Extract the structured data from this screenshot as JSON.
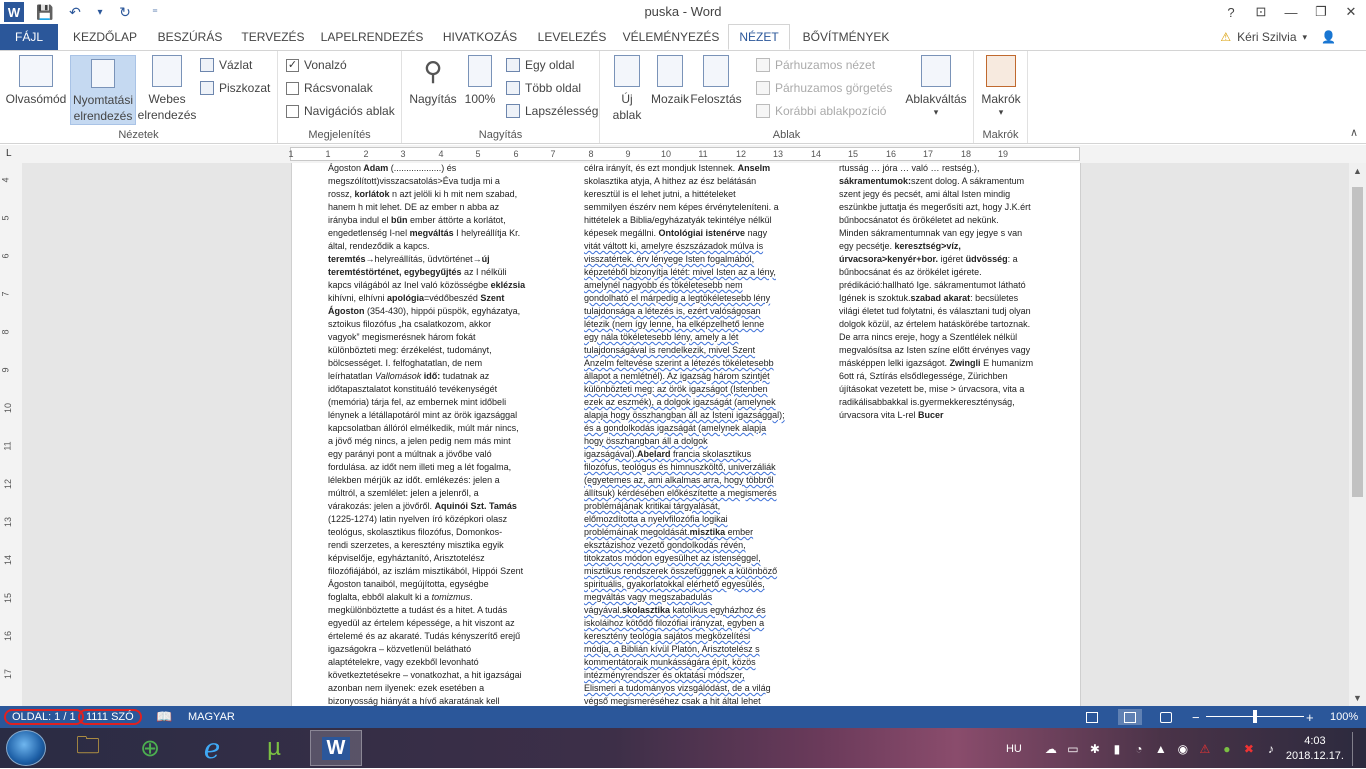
{
  "title_bar": {
    "doc_title": "puska - Word",
    "help": "?",
    "ribbon_display": "⊡",
    "minimize": "—",
    "restore": "❐",
    "close": "✕"
  },
  "qat": {
    "word_logo": "W",
    "save": "💾",
    "undo": "↶",
    "undo_dropdown": "▾",
    "redo": "↻",
    "customize": "⁼"
  },
  "tabs": [
    "FÁJL",
    "KEZDŐLAP",
    "BESZÚRÁS",
    "TERVEZÉS",
    "LAPELRENDEZÉS",
    "HIVATKOZÁS",
    "LEVELEZÉS",
    "VÉLEMÉNYEZÉS",
    "NÉZET",
    "BŐVÍTMÉNYEK"
  ],
  "user": {
    "name": "Kéri Szilvia",
    "warning_icon": "⚠",
    "dropdown": "▾",
    "avatar_icon": "👤"
  },
  "ribbon": {
    "nezetek": {
      "label": "Nézetek",
      "read": "Olvasómód",
      "print": "Nyomtatási elrendezés",
      "web": "Webes elrendezés",
      "outline": "Vázlat",
      "draft": "Piszkozat"
    },
    "megjelenites": {
      "label": "Megjelenítés",
      "ruler": "Vonalzó",
      "ruler_check": "✓",
      "gridlines": "Rácsvonalak",
      "nav": "Navigációs ablak"
    },
    "nagyitas": {
      "label": "Nagyítás",
      "zoom": "Nagyítás",
      "percent100": "100%",
      "one_page": "Egy oldal",
      "multi_page": "Több oldal",
      "page_width": "Lapszélesség"
    },
    "ablak": {
      "label": "Ablak",
      "new_window": "Új ablak",
      "arrange": "Mozaik",
      "split": "Felosztás",
      "side_by_side": "Párhuzamos nézet",
      "sync_scroll": "Párhuzamos görgetés",
      "reset_pos": "Korábbi ablakpozíció",
      "switch": "Ablakváltás",
      "switch_arrow": "▾"
    },
    "makrok": {
      "label": "Makrók",
      "macros": "Makrók",
      "macros_arrow": "▾"
    },
    "collapse": "∧"
  },
  "ruler_marks": [
    "1",
    "1",
    "2",
    "3",
    "4",
    "5",
    "6",
    "7",
    "8",
    "9",
    "10",
    "11",
    "12",
    "13",
    "14",
    "15",
    "16",
    "17",
    "18",
    "19"
  ],
  "ruler_corner": "L",
  "vruler_marks": [
    "4",
    "5",
    "6",
    "7",
    "8",
    "9",
    "10",
    "11",
    "12",
    "13",
    "14",
    "15",
    "16",
    "17"
  ],
  "document": {
    "col1": [
      "Ágoston<b> Adam</b> (...................) és",
      "megszólított)visszacsatolás>Éva tudja mi a",
      "rossz, <b>korlátok</b> n azt jelöli ki h mit nem szabad,",
      "hanem h mit lehet. DE az ember n abba az",
      "irányba indul el <b>bűn</b> ember áttörte a korlátot,",
      "engedetlenség I-nel <b>megváltás</b> I helyreállítja Kr.",
      "által, rendeződik a kapcs.",
      "<b>teremtés</b>→helyreállítás, üdvtörténet→<b>új</b>",
      "<b>teremtéstörténet, egybegyűjtés</b> az I nélküli",
      "kapcs világából az Inel való közösségbe <b>eklézsia</b>",
      "kihívni, elhívni <b>apológia</b>=védőbeszéd <b>Szent</b>",
      "<b>Ágoston</b> (354-430), hippói püspök, egyházatya,",
      "sztoikus filozófus „ha csalatkozom, akkor",
      "vagyok” megismerésnek három fokát",
      "különbözteti meg: érzékelést, tudományt,",
      "bölcsességet. I. felfoghatatlan, de nem",
      "leírhatatlan <i>Vallomások</i> <b>idő:</b> tudatnak az",
      "időtapasztalatot konstituáló tevékenységét",
      "(memória) tárja fel, az embernek mint időbeli",
      "lénynek a létállapotáról mint az örök igazsággal",
      "kapcsolatban állóról elmélkedik, múlt már nincs,",
      "a jövő még nincs, a jelen pedig nem más mint",
      "egy parányi pont a múltnak a jövőbe való",
      "fordulása. az időt nem illeti meg a lét fogalma,",
      "lélekben mérjük az időt. emlékezés: jelen a",
      "múltról, a szemlélet: jelen a jelenről, a",
      "várakozás: jelen a jövőről. <b>Aquinói Szt. Tamás</b>",
      "(1225-1274) latin nyelven író középkori olasz",
      "teológus, skolasztikus filozófus, Domonkos-",
      "rendi szerzetes, a keresztény misztika egyik",
      "képviselője, egyháztanító, Arisztotelész",
      "filozófiájából, az iszlám misztikából, Hippói Szent",
      "Ágoston tanaiból, megújította, egységbe",
      "foglalta, ebből alakult ki a <i>tomizmus</i>.",
      "megkülönböztette a tudást és a hitet. A tudás",
      "egyedül az értelem képessége, a hit viszont az",
      "értelemé és az akaraté. Tudás kényszerítő erejű",
      "igazságokra – közvetlenül belátható",
      "alaptételekre, vagy ezekből levonható",
      "következtetésekre – vonatkozhat, a hit igazságai",
      "azonban nem ilyenek: ezek esetében a",
      "bizonyosság hiányát a hívő akaratának kell"
    ],
    "col2": [
      "célra irányít, és ezt mondjuk Istennek. <b>Anselm</b>",
      "skolasztika atyja, A hithez az ész belátásán",
      "keresztül is el lehet jutni, a hittételeket",
      "semmilyen észérv nem képes érvényteleníteni. a",
      "hittételek a Biblia/egyházatyák tekintélye nélkül",
      "képesek megállni. <b>Ontológiai istenérve</b> nagy",
      "vitát váltott ki, amelyre észszázadok múlva is",
      "visszatértek. érv lényege Isten fogalmából,",
      "képzetéből bizonyítja létét: mivel Isten az a lény,",
      "amelynél nagyobb és tökéletesebb nem",
      "gondolható el márpedig a legtökéletesebb lény",
      "tulajdonsága a létezés is, ezért valóságosan",
      "létezik (nem így lenne, ha elképzelhető lenne",
      "egy nála tökéletesebb lény, amely a lét",
      "tulajdonságával is rendelkezik, mivel Szent",
      "Anzelm feltevése szerint a létezés tökéletesebb",
      "állapot a nemlétnél). Az igazság három szintjét",
      "különbözteti meg: az örök igazságot (Istenben",
      "ezek az eszmék), a dolgok igazságát (amelynek",
      "alapja hogy összhangban áll az Isteni igazsággal);",
      "és a gondolkodás igazságát (amelynek alapja",
      "hogy összhangban áll a dolgok",
      "igazságával).<b>Abelard</b> francia skolasztikus",
      "filozófus, teológus és himnuszköltő, univerzáliák",
      "(egyetemes az, ami alkalmas arra, hogy többről",
      "állítsuk) kérdésében előkészítette a megismerés",
      "problémájának kritikai tárgyalását,",
      "előmozdította a nyelvfilozófia logikai",
      "problémáinak megoldását.<b>misztika</b> ember",
      "eksztázishoz vezető gondolkodás révén,",
      "titokzatos módon egyesülhet az istenséggel,",
      "misztikus rendszerek összefüggnek a különböző",
      "spirituális, gyakorlatokkal elérhető egyesülés,",
      "megváltás vagy megszabadulás",
      "vágyával.<b>skolasztika</b> katolikus egyházhoz és",
      "iskoláihoz kötődő filozófiai irányzat, egyben a",
      "keresztény teológia sajátos megközelítési",
      "módja, a Biblián kívül Platón, Arisztotelész s",
      "kommentátoraik munkásságára épít, közös",
      "intézményrendszer és oktatási módszer,",
      "Elismeri a tudományos vizsgálódást, de a világ",
      "végső megismeréséhez csak a hit által lehet"
    ],
    "col3": [
      "rtusság … jóra … való … restség.),",
      "<b>sákramentumok:</b>szent dolog. A sákramentum",
      "szent jegy és pecsét, ami által Isten mindig",
      "eszünkbe juttatja és megerősíti azt, hogy J.K.ért",
      "bűnbocsánatot és örökéletet ad nekünk.",
      "Minden sákramentumnak van egy jegye s van",
      "egy pecsétje. <b>keresztség&gt;víz,</b>",
      "<b>úrvacsora&gt;kenyér+bor.</b> igéret <b>üdvösség</b>: a",
      "bűnbocsánat és az örökélet igérete.",
      "prédikáció:hallható Ige. sákramentumot látható",
      "Igének is szoktuk.<b>szabad akarat</b>: becsületes",
      "világi életet tud folytatni, és választani tudj olyan",
      "dolgok közül, az értelem hatáskörébe tartoznak.",
      "De arra nincs ereje, hogy a Szentlélek nélkül",
      "megvalósítsa az Isten színe előtt érvényes vagy",
      "másképpen lelki igazságot. <b>Zwingli</b> E humanizm",
      "6ott rá, Sztírás elsődlegessége, Zürichben",
      "újításokat vezetett be, mise &gt; úrvacsora, vita a",
      "radikálisabbakkal is.gyermekkeresztényság,",
      "úrvacsora vita L-rel <b>Bucer</b>"
    ]
  },
  "status": {
    "page": "OLDAL: 1 / 1",
    "words": "1111 SZÓ",
    "proofing_icon": "📖",
    "language": "MAGYAR",
    "zoom_minus": "−",
    "zoom_plus": "+",
    "zoom": "100%",
    "zoom_level_percent": 100
  },
  "taskbar": {
    "lang": "HU",
    "time": "4:03",
    "date": "2018.12.17.",
    "apps": [
      "file-explorer",
      "chrome",
      "internet-explorer",
      "utorrent",
      "word"
    ],
    "app_glyphs": [
      "🗀",
      "⊕",
      "e",
      "µ",
      "W"
    ],
    "tray_glyphs": [
      "☁",
      "▭",
      "✱",
      "▮",
      "◔",
      "▲",
      "◉",
      "⚠",
      "●",
      "✖",
      "♪"
    ]
  },
  "colors": {
    "accent": "#2b579a",
    "status_circle": "#e02020"
  }
}
